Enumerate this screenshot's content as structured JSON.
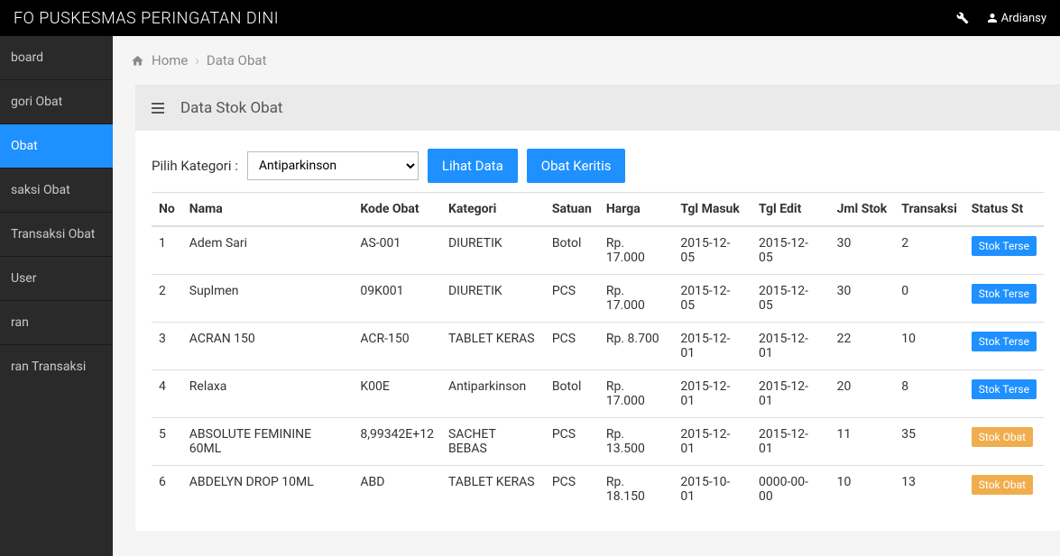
{
  "topbar": {
    "title": "FO PUSKESMAS PERINGATAN DINI",
    "user": "Ardiansy"
  },
  "sidebar": {
    "items": [
      {
        "label": "board",
        "active": false
      },
      {
        "label": "gori Obat",
        "active": false
      },
      {
        "label": "Obat",
        "active": true
      },
      {
        "label": "saksi Obat",
        "active": false
      },
      {
        "label": "Transaksi Obat",
        "active": false
      },
      {
        "label": "User",
        "active": false
      },
      {
        "label": "ran",
        "active": false
      },
      {
        "label": "ran Transaksi",
        "active": false
      }
    ]
  },
  "breadcrumb": {
    "home": "Home",
    "current": "Data Obat"
  },
  "panel": {
    "title": "Data Stok Obat"
  },
  "controls": {
    "label": "Pilih Kategori :",
    "selected": "Antiparkinson",
    "lihat": "Lihat Data",
    "keritis": "Obat Keritis"
  },
  "table": {
    "headers": [
      "No",
      "Nama",
      "Kode Obat",
      "Kategori",
      "Satuan",
      "Harga",
      "Tgl Masuk",
      "Tgl Edit",
      "Jml Stok",
      "Transaksi",
      "Status St"
    ],
    "rows": [
      {
        "no": "1",
        "nama": "Adem Sari",
        "kode": "AS-001",
        "kategori": "DIURETIK",
        "satuan": "Botol",
        "harga": "Rp. 17.000",
        "masuk": "2015-12-05",
        "edit": "2015-12-05",
        "stok": "30",
        "trans": "2",
        "status": "Stok Terse",
        "statusClass": "blue"
      },
      {
        "no": "2",
        "nama": "Suplmen",
        "kode": "09K001",
        "kategori": "DIURETIK",
        "satuan": "PCS",
        "harga": "Rp. 17.000",
        "masuk": "2015-12-05",
        "edit": "2015-12-05",
        "stok": "30",
        "trans": "0",
        "status": "Stok Terse",
        "statusClass": "blue"
      },
      {
        "no": "3",
        "nama": "ACRAN 150",
        "kode": "ACR-150",
        "kategori": "TABLET KERAS",
        "satuan": "PCS",
        "harga": "Rp. 8.700",
        "masuk": "2015-12-01",
        "edit": "2015-12-01",
        "stok": "22",
        "trans": "10",
        "status": "Stok Terse",
        "statusClass": "blue"
      },
      {
        "no": "4",
        "nama": "Relaxa",
        "kode": "K00E",
        "kategori": "Antiparkinson",
        "satuan": "Botol",
        "harga": "Rp. 17.000",
        "masuk": "2015-12-01",
        "edit": "2015-12-01",
        "stok": "20",
        "trans": "8",
        "status": "Stok Terse",
        "statusClass": "blue"
      },
      {
        "no": "5",
        "nama": "ABSOLUTE FEMININE 60ML",
        "kode": "8,99342E+12",
        "kategori": "SACHET BEBAS",
        "satuan": "PCS",
        "harga": "Rp. 13.500",
        "masuk": "2015-12-01",
        "edit": "2015-12-01",
        "stok": "11",
        "trans": "35",
        "status": "Stok Obat",
        "statusClass": "yellow"
      },
      {
        "no": "6",
        "nama": "ABDELYN DROP 10ML",
        "kode": "ABD",
        "kategori": "TABLET KERAS",
        "satuan": "PCS",
        "harga": "Rp. 18.150",
        "masuk": "2015-10-01",
        "edit": "0000-00-00",
        "stok": "10",
        "trans": "13",
        "status": "Stok Obat",
        "statusClass": "yellow"
      }
    ]
  }
}
